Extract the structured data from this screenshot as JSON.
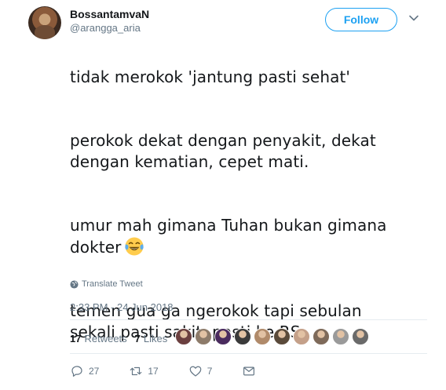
{
  "user": {
    "name": "BossantamvaN",
    "handle": "@arangga_aria"
  },
  "follow_label": "Follow",
  "tweet": {
    "paragraphs": [
      "tidak merokok 'jantung pasti sehat'",
      "perokok dekat dengan penyakit, dekat\ndengan kematian, cepet mati.",
      "umur mah gimana Tuhan bukan gimana\ndokter",
      "temen gua ga ngerokok tapi sebulan\nsekali pasti sakit, pasti ke RS."
    ],
    "emoji": "face-with-tears-of-joy"
  },
  "translate_label": "Translate Tweet",
  "timestamp": "2:33 PM - 24 Jun 2018",
  "stats": {
    "retweets_count": "17",
    "retweets_label": "Retweets",
    "likes_count": "7",
    "likes_label": "Likes"
  },
  "liker_avatar_colors": [
    "#6b3f3f",
    "#8d7b6a",
    "#4a2b5e",
    "#3a3a3a",
    "#b08a6a",
    "#5a4a3a",
    "#c4a089",
    "#7e6a5a",
    "#9a9a9a",
    "#6a6a6a"
  ],
  "actions": {
    "reply_count": "27",
    "retweet_count": "17",
    "like_count": "7"
  },
  "colors": {
    "accent": "#1da1f2",
    "secondary_text": "#657786",
    "divider": "#e6ecf0"
  }
}
